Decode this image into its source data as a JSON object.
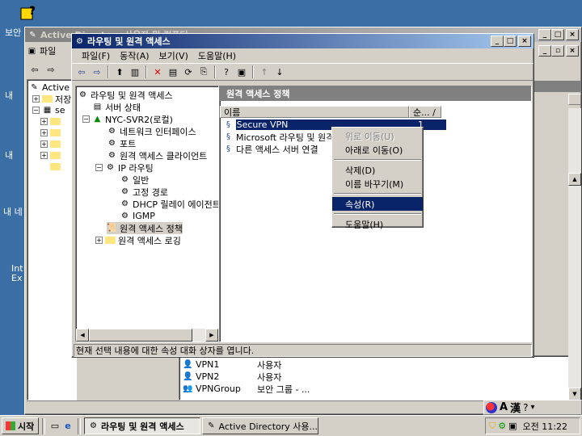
{
  "desktop": {
    "icons": [
      "보안",
      "내",
      "내",
      "내 네",
      "Int",
      "Ex"
    ],
    "help_icon": "help-icon"
  },
  "bg_window": {
    "title": "Active Directory 사용자 및 컴퓨터",
    "menu_first": "파일",
    "tree_items": [
      "Active",
      "저장",
      "se",
      "",
      "",
      "",
      "",
      ""
    ],
    "list_rows": [
      {
        "name": "VPN1",
        "type": "사용자"
      },
      {
        "name": "VPN2",
        "type": "사용자"
      },
      {
        "name": "VPNGroup",
        "type": "보안 그룹 - ..."
      }
    ]
  },
  "rras": {
    "title": "라우팅 및 원격 액세스",
    "menu": [
      "파일(F)",
      "동작(A)",
      "보기(V)",
      "도움말(H)"
    ],
    "tree": {
      "root": "라우팅 및 원격 액세스",
      "server_status": "서버 상태",
      "server": "NYC-SVR2(로컬)",
      "network_interfaces": "네트워크 인터페이스",
      "ports": "포트",
      "remote_clients": "원격 액세스 클라이언트",
      "ip_routing": "IP 라우팅",
      "general": "일반",
      "static_routes": "고정 경로",
      "dhcp_relay": "DHCP 릴레이 에이전트",
      "igmp": "IGMP",
      "remote_policies": "원격 액세스 정책",
      "remote_logging": "원격 액세스 로깅"
    },
    "pane_title": "원격 액세스 정책",
    "columns": {
      "name": "이름",
      "order": "순... /"
    },
    "policies": [
      {
        "name": "Secure VPN",
        "order": "1"
      },
      {
        "name": "Microsoft 라우팅 및 원격",
        "order": ""
      },
      {
        "name": "다른 액세스 서버 연결",
        "order": ""
      }
    ],
    "status": "현재 선택 내용에 대한 속성 대화 상자를 엽니다."
  },
  "context_menu": {
    "move_up": "위로 이동(U)",
    "move_down": "아래로 이동(O)",
    "delete": "삭제(D)",
    "rename": "이름 바꾸기(M)",
    "properties": "속성(R)",
    "help": "도움말(H)"
  },
  "taskbar": {
    "start": "시작",
    "tasks": [
      "라우팅 및 원격 액세스",
      "Active Directory 사용..."
    ],
    "tray_ime": "A",
    "tray_hanja": "漢",
    "clock": "오전 11:22"
  },
  "colors": {
    "desktop": "#3a6ea5",
    "title_active": "#0a246a",
    "selection": "#0a246a",
    "face": "#d4d0c8"
  }
}
